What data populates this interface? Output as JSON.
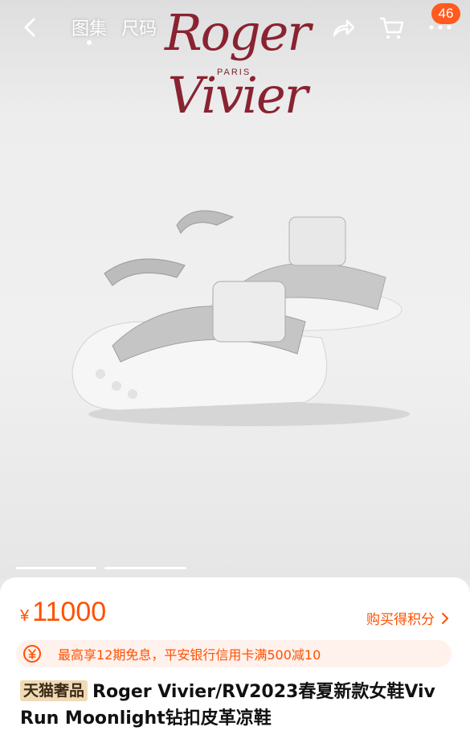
{
  "header": {
    "tabs": [
      {
        "label": "图集",
        "active": true
      },
      {
        "label": "尺码",
        "active": false
      }
    ],
    "brand_logo": "Roger Vivier",
    "brand_sub": "PARIS",
    "cart_badge": "46",
    "icons": {
      "back": "back-chevron-icon",
      "share": "share-icon",
      "cart": "cart-icon",
      "more": "more-dots-icon"
    }
  },
  "product": {
    "price_symbol": "¥",
    "price": "11000",
    "points_label": "购买得积分",
    "promo_text": "最高享12期免息，平安银行信用卡满500减10",
    "tag": "天猫奢品",
    "title": "Roger Vivier/RV2023春夏新款女鞋Viv Run Moonlight钻扣皮革凉鞋"
  },
  "colors": {
    "accent": "#ff5000",
    "brand": "#8a2331",
    "badge": "#ff5a1f",
    "tag_bg": "#f0d9b6"
  }
}
